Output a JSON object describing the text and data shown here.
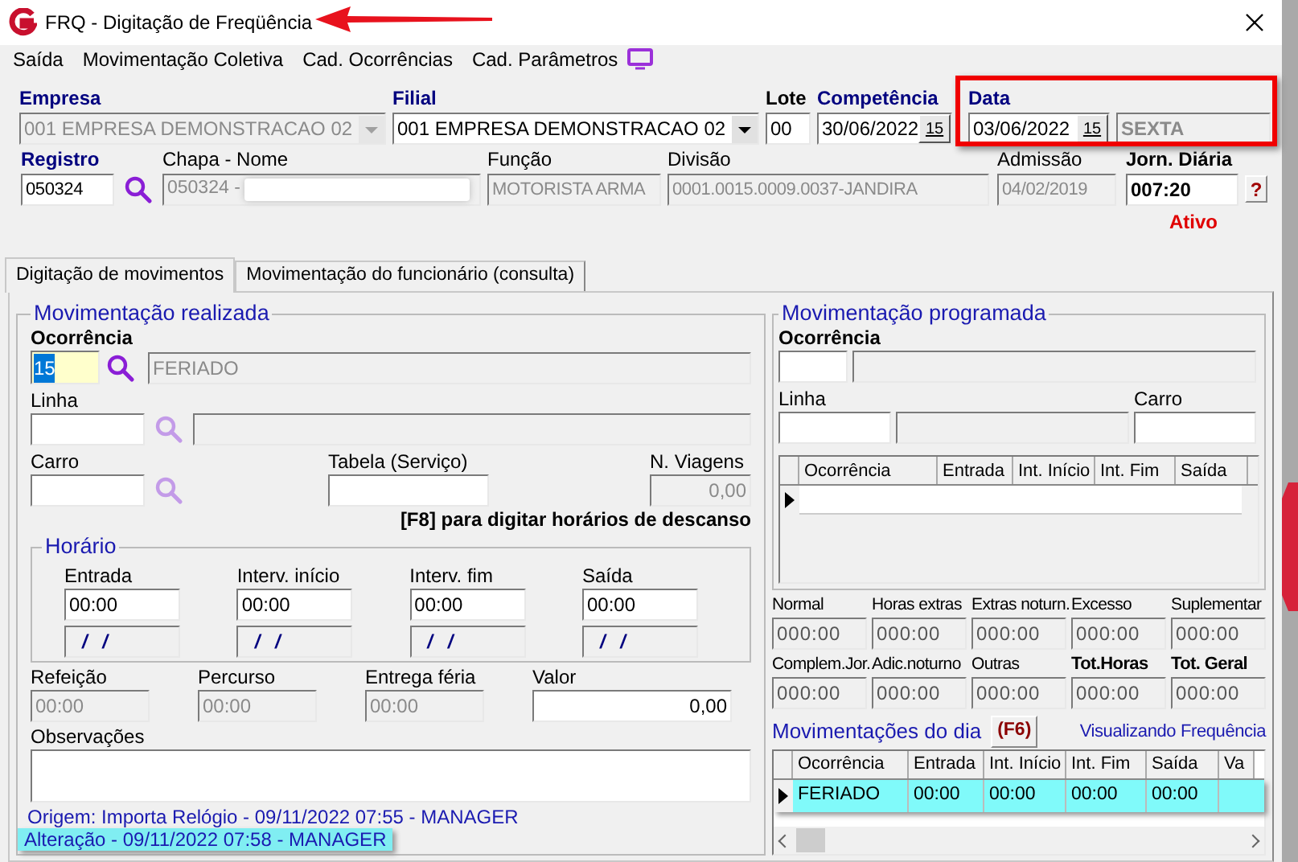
{
  "window": {
    "title": "FRQ - Digitação de Freqüência"
  },
  "menu": [
    {
      "label": "Saída"
    },
    {
      "label": "Movimentação Coletiva"
    },
    {
      "label": "Cad. Ocorrências"
    },
    {
      "label": "Cad. Parâmetros"
    }
  ],
  "header_row_1": [
    {
      "kind": "combo",
      "label": "Empresa",
      "required": true,
      "bold": true,
      "value": "001 EMPRESA DEMONSTRACAO 02",
      "disabled": true
    },
    {
      "kind": "combo",
      "label": "Filial",
      "required": true,
      "bold": true,
      "value": "001 EMPRESA DEMONSTRACAO 02",
      "disabled": false
    },
    {
      "kind": "text",
      "label": "Lote",
      "required": false,
      "bold": true,
      "value": "00",
      "disabled": false
    },
    {
      "kind": "date",
      "label": "Competência",
      "required": true,
      "bold": true,
      "value": "30/06/2022",
      "button": "15",
      "disabled": false
    },
    {
      "kind": "date",
      "label": "Data",
      "required": true,
      "bold": true,
      "value": "03/06/2022",
      "button": "15",
      "disabled": false
    },
    {
      "kind": "weekday",
      "value": "SEXTA",
      "disabled": true
    }
  ],
  "header_row_2": [
    {
      "kind": "lookup",
      "label": "Registro",
      "required": true,
      "bold": true,
      "value": "050324",
      "disabled": false
    },
    {
      "kind": "redacted",
      "label": "Chapa  -  Nome",
      "required": false,
      "bold": false,
      "value": "050324 -",
      "disabled": true
    },
    {
      "kind": "text",
      "label": "Função",
      "required": false,
      "bold": false,
      "value": "MOTORISTA ARMA",
      "disabled": true
    },
    {
      "kind": "text",
      "label": "Divisão",
      "required": false,
      "bold": false,
      "value": "0001.0015.0009.0037-JANDIRA",
      "disabled": true
    },
    {
      "kind": "text",
      "label": "Admissão",
      "required": false,
      "bold": false,
      "value": "04/02/2019",
      "disabled": true
    },
    {
      "kind": "help",
      "label": "Jorn. Diária",
      "required": false,
      "bold": true,
      "value": "007:20",
      "disabled": false
    }
  ],
  "help_button": "?",
  "status": "Ativo",
  "tabs": [
    {
      "label": "Digitação de movimentos",
      "selected": true
    },
    {
      "label": "Movimentação do funcionário (consulta)",
      "selected": false
    }
  ],
  "realizada": {
    "title": "Movimentação realizada",
    "ocorrencia": {
      "label": "Ocorrência",
      "code": "15",
      "code_selected": true,
      "description": "FERIADO"
    },
    "linha": {
      "label": "Linha",
      "lookup_enabled": false
    },
    "carro": {
      "label": "Carro",
      "lookup_enabled": false
    },
    "tabela": {
      "label": "Tabela (Serviço)"
    },
    "viagens": {
      "label": "N. Viagens",
      "value": "0,00"
    },
    "hint": "[F8] para digitar horários de descanso",
    "horario": {
      "title": "Horário",
      "columns": [
        {
          "label": "Entrada",
          "time": "00:00",
          "date": "/ /"
        },
        {
          "label": "Interv. início",
          "time": "00:00",
          "date": "/ /"
        },
        {
          "label": "Interv. fim",
          "time": "00:00",
          "date": "/ /"
        },
        {
          "label": "Saída",
          "time": "00:00",
          "date": "/ /"
        }
      ]
    },
    "extras": [
      {
        "label": "Refeição",
        "value": "00:00",
        "disabled": true
      },
      {
        "label": "Percurso",
        "value": "00:00",
        "disabled": true
      },
      {
        "label": "Entrega féria",
        "value": "00:00",
        "disabled": true
      },
      {
        "label": "Valor",
        "value": "0,00",
        "disabled": false
      }
    ],
    "observacoes": {
      "label": "Observações"
    },
    "audit": [
      {
        "text": "Origem: Importa Relógio - 09/11/2022 07:55 - MANAGER",
        "highlighted": false
      },
      {
        "text": "Alteração - 09/11/2022 07:58 - MANAGER",
        "highlighted": true
      }
    ]
  },
  "programada": {
    "title": "Movimentação programada",
    "ocorrencia_label": "Ocorrência",
    "linha_label": "Linha",
    "carro_label": "Carro",
    "grid": {
      "columns": [
        "Ocorrência",
        "Entrada",
        "Int. Início",
        "Int. Fim",
        "Saída"
      ]
    }
  },
  "totals": [
    {
      "label": "Normal",
      "value": "000:00",
      "bold": false
    },
    {
      "label": "Horas extras",
      "value": "000:00",
      "bold": false
    },
    {
      "label": "Extras noturn.",
      "value": "000:00",
      "bold": false
    },
    {
      "label": "Excesso",
      "value": "000:00",
      "bold": false
    },
    {
      "label": "Suplementar",
      "value": "000:00",
      "bold": false
    },
    {
      "label": "Complem.Jor.",
      "value": "000:00",
      "bold": false
    },
    {
      "label": "Adic.noturno",
      "value": "000:00",
      "bold": false
    },
    {
      "label": "Outras",
      "value": "000:00",
      "bold": false
    },
    {
      "label": "Tot.Horas",
      "value": "000:00",
      "bold": true
    },
    {
      "label": "Tot. Geral",
      "value": "000:00",
      "bold": true
    }
  ],
  "dia": {
    "title": "Movimentações do dia",
    "shortcut": "(F6)",
    "mode": "Visualizando Frequência",
    "grid": {
      "columns": [
        "Ocorrência",
        "Entrada",
        "Int. Início",
        "Int. Fim",
        "Saída",
        "Va"
      ],
      "rows": [
        {
          "cells": [
            "FERIADO",
            "00:00",
            "00:00",
            "00:00",
            "00:00"
          ],
          "highlighted": true
        }
      ]
    }
  }
}
